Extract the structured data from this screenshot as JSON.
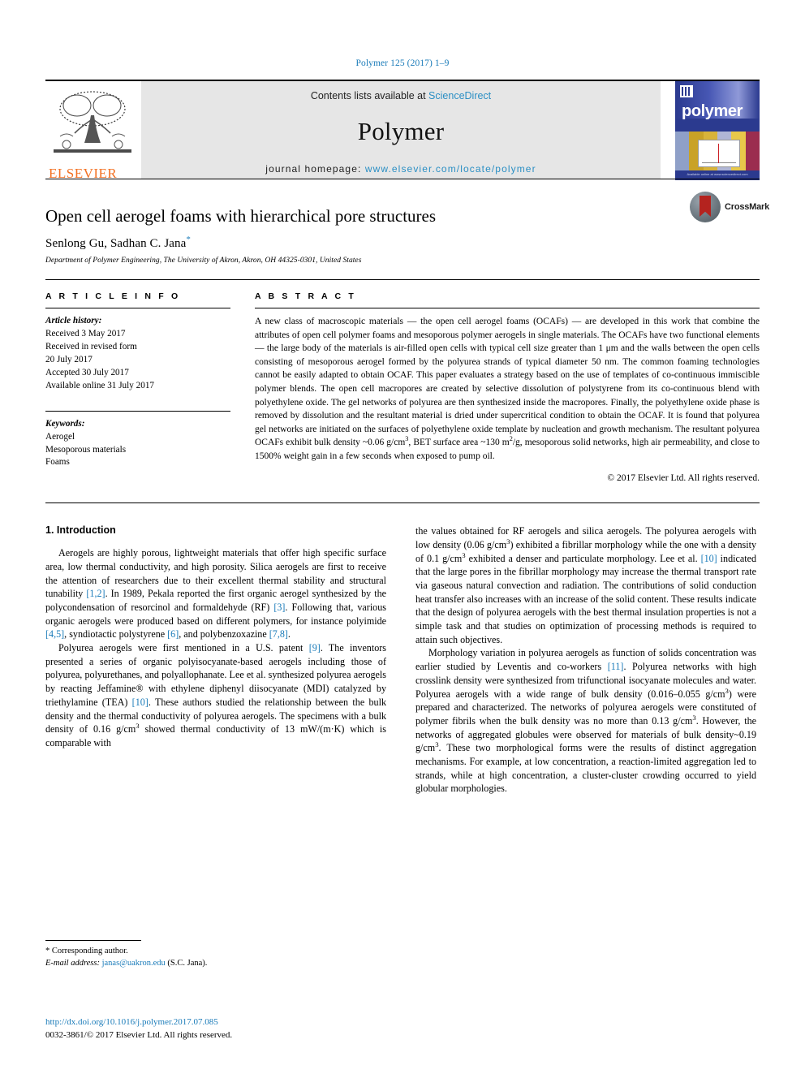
{
  "running_head": "Polymer 125 (2017) 1–9",
  "banner": {
    "contents_prefix": "Contents lists available at ",
    "contents_link": "ScienceDirect",
    "journal_name": "Polymer",
    "homepage_prefix": "journal homepage: ",
    "homepage_url": "www.elsevier.com/locate/polymer",
    "publisher_logo_text": "ELSEVIER",
    "cover_title": "polymer",
    "cover_footer": "Available online at www.sciencedirect.com"
  },
  "article": {
    "title": "Open cell aerogel foams with hierarchical pore structures",
    "authors": "Senlong Gu, Sadhan C. Jana",
    "corresponding_marker": "*",
    "affiliation": "Department of Polymer Engineering, The University of Akron, Akron, OH 44325-0301, United States",
    "crossmark_label": "CrossMark"
  },
  "article_info": {
    "heading": "A R T I C L E   I N F O",
    "history_label": "Article history:",
    "history": [
      "Received 3 May 2017",
      "Received in revised form",
      "20 July 2017",
      "Accepted 30 July 2017",
      "Available online 31 July 2017"
    ],
    "keywords_label": "Keywords:",
    "keywords": [
      "Aerogel",
      "Mesoporous materials",
      "Foams"
    ]
  },
  "abstract": {
    "heading": "A B S T R A C T",
    "text": "A new class of macroscopic materials — the open cell aerogel foams (OCAFs) — are developed in this work that combine the attributes of open cell polymer foams and mesoporous polymer aerogels in single materials. The OCAFs have two functional elements — the large body of the materials is air-filled open cells with typical cell size greater than 1 μm and the walls between the open cells consisting of mesoporous aerogel formed by the polyurea strands of typical diameter 50 nm. The common foaming technologies cannot be easily adapted to obtain OCAF. This paper evaluates a strategy based on the use of templates of co-continuous immiscible polymer blends. The open cell macropores are created by selective dissolution of polystyrene from its co-continuous blend with polyethylene oxide. The gel networks of polyurea are then synthesized inside the macropores. Finally, the polyethylene oxide phase is removed by dissolution and the resultant material is dried under supercritical condition to obtain the OCAF. It is found that polyurea gel networks are initiated on the surfaces of polyethylene oxide template by nucleation and growth mechanism. The resultant polyurea OCAFs exhibit bulk density ~0.06 g/cm3, BET surface area ~130 m2/g, mesoporous solid networks, high air permeability, and close to 1500% weight gain in a few seconds when exposed to pump oil.",
    "copyright": "© 2017 Elsevier Ltd. All rights reserved."
  },
  "body": {
    "section_number_title": "1. Introduction",
    "left_paragraphs": [
      "Aerogels are highly porous, lightweight materials that offer high specific surface area, low thermal conductivity, and high porosity. Silica aerogels are first to receive the attention of researchers due to their excellent thermal stability and structural tunability [1,2]. In 1989, Pekala reported the first organic aerogel synthesized by the polycondensation of resorcinol and formaldehyde (RF) [3]. Following that, various organic aerogels were produced based on different polymers, for instance polyimide [4,5], syndiotactic polystyrene [6], and polybenzoxazine [7,8].",
      "Polyurea aerogels were first mentioned in a U.S. patent [9]. The inventors presented a series of organic polyisocyanate-based aerogels including those of polyurea, polyurethanes, and polyallophanate. Lee et al. synthesized polyurea aerogels by reacting Jeffamine® with ethylene diphenyl diisocyanate (MDI) catalyzed by triethylamine (TEA) [10]. These authors studied the relationship between the bulk density and the thermal conductivity of polyurea aerogels. The specimens with a bulk density of 0.16 g/cm3 showed thermal conductivity of 13 mW/(m·K) which is comparable with"
    ],
    "right_paragraphs": [
      "the values obtained for RF aerogels and silica aerogels. The polyurea aerogels with low density (0.06 g/cm3) exhibited a fibrillar morphology while the one with a density of 0.1 g/cm3 exhibited a denser and particulate morphology. Lee et al. [10] indicated that the large pores in the fibrillar morphology may increase the thermal transport rate via gaseous natural convection and radiation. The contributions of solid conduction heat transfer also increases with an increase of the solid content. These results indicate that the design of polyurea aerogels with the best thermal insulation properties is not a simple task and that studies on optimization of processing methods is required to attain such objectives.",
      "Morphology variation in polyurea aerogels as function of solids concentration was earlier studied by Leventis and co-workers [11]. Polyurea networks with high crosslink density were synthesized from trifunctional isocyanate molecules and water. Polyurea aerogels with a wide range of bulk density (0.016–0.055 g/cm3) were prepared and characterized. The networks of polyurea aerogels were constituted of polymer fibrils when the bulk density was no more than 0.13 g/cm3. However, the networks of aggregated globules were observed for materials of bulk density~0.19 g/cm3. These two morphological forms were the results of distinct aggregation mechanisms. For example, at low concentration, a reaction-limited aggregation led to strands, while at high concentration, a cluster-cluster crowding occurred to yield globular morphologies."
    ]
  },
  "footnote": {
    "corresponding": "* Corresponding author.",
    "email_label": "E-mail address:",
    "email": "janas@uakron.edu",
    "email_suffix": "(S.C. Jana)."
  },
  "footer": {
    "doi": "http://dx.doi.org/10.1016/j.polymer.2017.07.085",
    "issn_line": "0032-3861/© 2017 Elsevier Ltd. All rights reserved."
  },
  "colors": {
    "link": "#1a7bb9",
    "banner_bg": "#e6e6e6",
    "elsevier_orange": "#f37021",
    "cover_blue": "#2b3a8f"
  }
}
